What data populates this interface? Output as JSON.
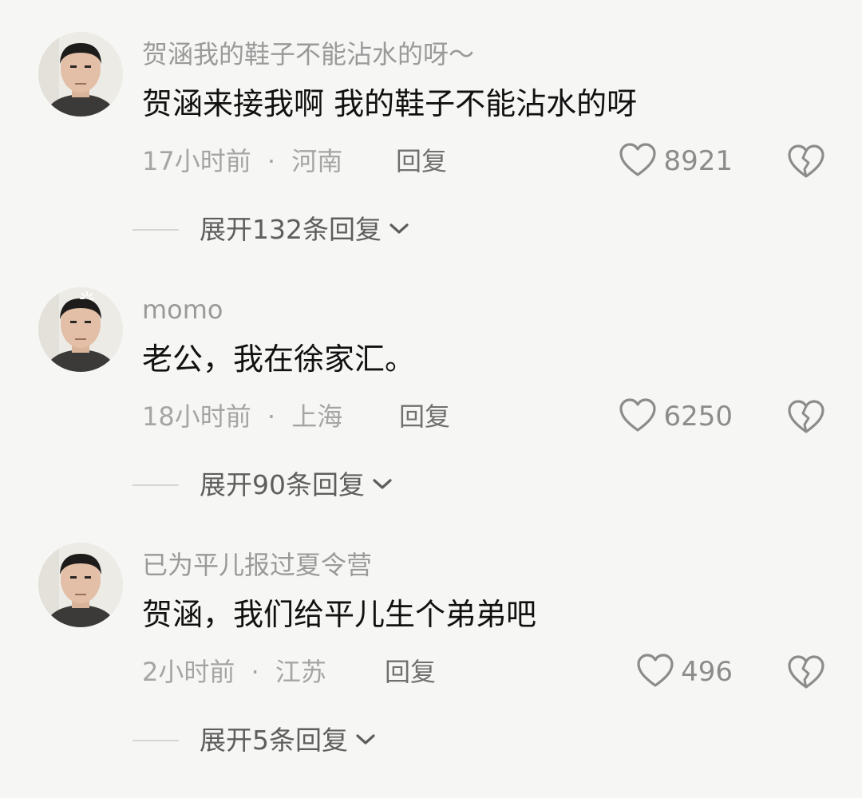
{
  "comments": [
    {
      "username": "贺涵我的鞋子不能沾水的呀～",
      "text": "贺涵来接我啊 我的鞋子不能沾水的呀",
      "time": "17小时前",
      "separator": "·",
      "location": "河南",
      "reply_label": "回复",
      "likes": "8921",
      "expand_label": "展开132条回复"
    },
    {
      "username": "momo",
      "text": "老公，我在徐家汇。",
      "time": "18小时前",
      "separator": "·",
      "location": "上海",
      "reply_label": "回复",
      "likes": "6250",
      "expand_label": "展开90条回复"
    },
    {
      "username": "已为平儿报过夏令营",
      "text": "贺涵，我们给平儿生个弟弟吧",
      "time": "2小时前",
      "separator": "·",
      "location": "江苏",
      "reply_label": "回复",
      "likes": "496",
      "expand_label": "展开5条回复"
    }
  ],
  "icons": {
    "like": "heart-outline-icon",
    "dislike": "broken-heart-icon",
    "expand": "chevron-down-icon"
  },
  "colors": {
    "background": "#f6f6f4",
    "username": "#9a9a9a",
    "text": "#111111",
    "meta": "#a5a5a5"
  }
}
